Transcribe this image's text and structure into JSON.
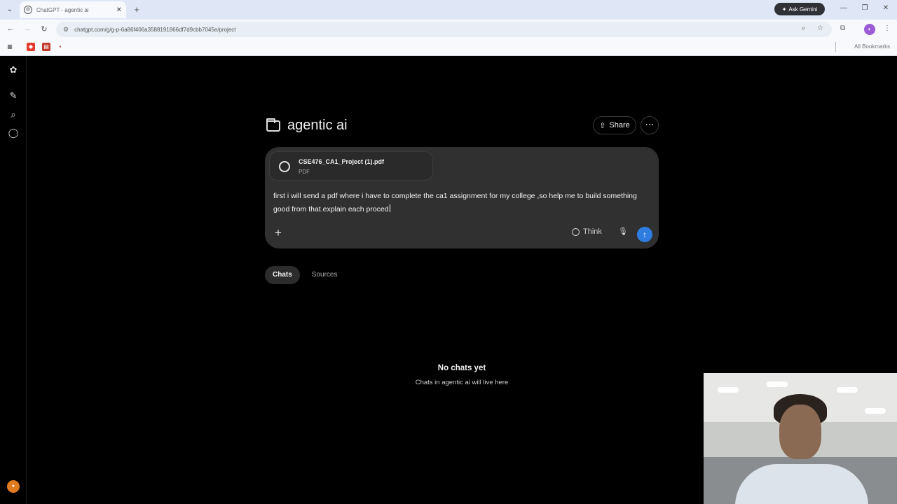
{
  "browser": {
    "tab_title": "ChatGPT - agentic ai",
    "ask_gemini": "Ask Gemini",
    "url": "chatgpt.com/g/g-p-6a86f406a3588191866df7d9cbb7045e/project",
    "all_bookmarks": "All Bookmarks"
  },
  "project": {
    "title": "agentic ai",
    "share_label": "Share"
  },
  "composer": {
    "attachment_name": "CSE476_CA1_Project (1).pdf",
    "attachment_type": "PDF",
    "prompt": "first i will send a pdf where i have to complete the ca1 assignment for my college ,so help me to build something good from that.explain each proced",
    "think_label": "Think"
  },
  "tabs": [
    {
      "label": "Chats",
      "active": true
    },
    {
      "label": "Sources",
      "active": false
    }
  ],
  "empty_state": {
    "title": "No chats yet",
    "subtitle": "Chats in agentic ai will live here"
  },
  "colors": {
    "accent": "#2f7de1",
    "composer_bg": "#303030",
    "avatar": "#e07a1f"
  }
}
